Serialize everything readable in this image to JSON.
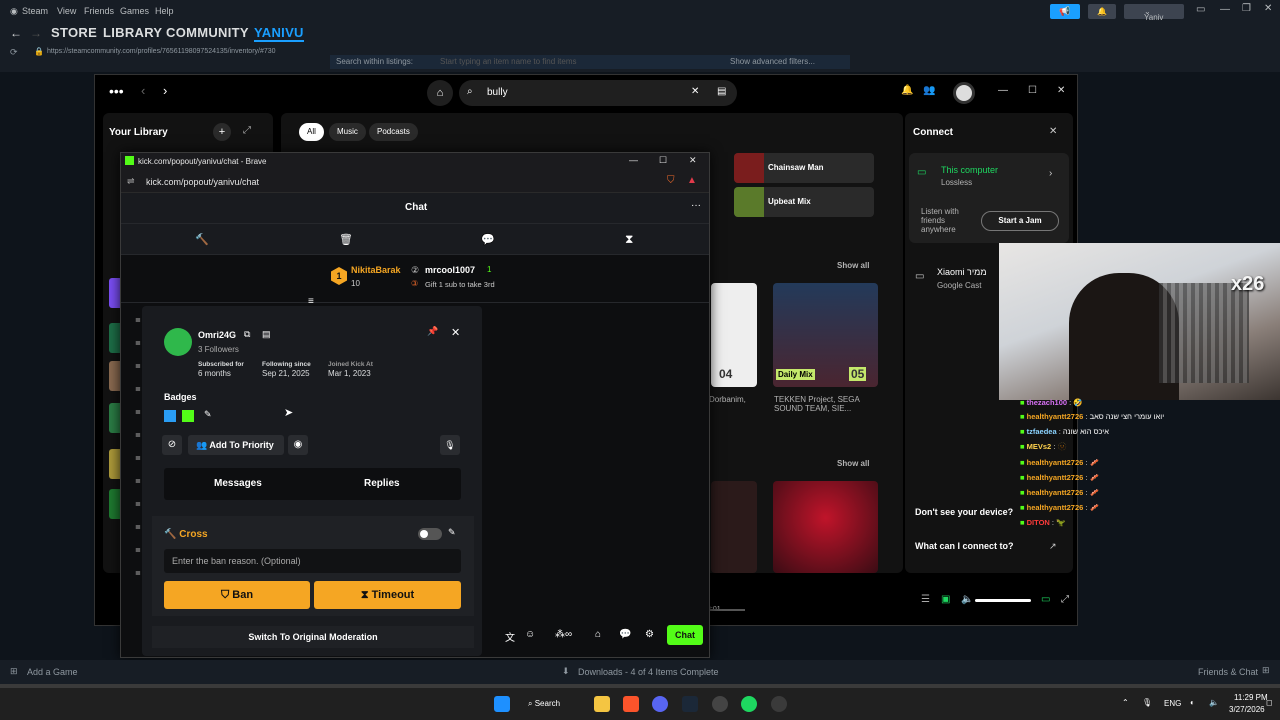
{
  "steam": {
    "menu": [
      "Steam",
      "View",
      "Friends",
      "Games",
      "Help"
    ],
    "nav_tabs": [
      "STORE",
      "LIBRARY",
      "COMMUNITY",
      "YANIVU"
    ],
    "user": "Yaniv",
    "url": "https://steamcommunity.com/profiles/76561198097524135/inventory/#730",
    "search_listings_label": "Search within listings:",
    "search_listings_placeholder": "Start typing an item name to find items",
    "advanced_filters": "Show advanced filters...",
    "add_game": "Add a Game",
    "downloads": "Downloads - 4 of 4 Items Complete",
    "friends_chat": "Friends & Chat"
  },
  "spotify": {
    "search_value": "bully",
    "library_title": "Your Library",
    "filters": [
      "All",
      "Music",
      "Podcasts"
    ],
    "cards": [
      {
        "label": "Chainsaw Man",
        "color": "#7a1d1d"
      },
      {
        "label": "Upbeat Mix",
        "color": "#5a7a2a"
      }
    ],
    "show_all": "Show all",
    "album_titles": [
      "Dorbanim,",
      "TEKKEN Project, SEGA SOUND TEAM, SIE..."
    ],
    "album_badges": [
      "04",
      "05"
    ],
    "daily_mix": "Daily Mix",
    "time": "3:01",
    "connect": {
      "title": "Connect",
      "this_computer": "This computer",
      "lossless": "Lossless",
      "listen_with": "Listen with friends anywhere",
      "start_jam": "Start a Jam",
      "device_name": "Xiaomi ממיר",
      "device_type": "Google Cast",
      "dont_see": "Don't see your device?",
      "what_connect": "What can I connect to?"
    }
  },
  "brave": {
    "title": "kick.com/popout/yanivu/chat - Brave",
    "url": "kick.com/popout/yanivu/chat"
  },
  "kick": {
    "chat_title": "Chat",
    "leader1": {
      "name": "NikitaBarak",
      "count": "10"
    },
    "leader2": {
      "name": "mrcool1007",
      "count": "1",
      "sub": "Gift 1 sub to take 3rd"
    },
    "chat_button": "Chat",
    "profile": {
      "username": "Omri24G",
      "followers": "3 Followers",
      "subscribed_label": "Subscribed for",
      "subscribed_value": "6 months",
      "following_label": "Following since",
      "following_value": "Sep 21, 2025",
      "joined_label": "Joined Kick At",
      "joined_value": "Mar 1, 2023",
      "badges_label": "Badges",
      "add_priority": "Add To Priority",
      "tab_messages": "Messages",
      "tab_replies": "Replies",
      "cross_label": "Cross",
      "ban_placeholder": "Enter the ban reason. (Optional)",
      "ban": "Ban",
      "timeout": "Timeout",
      "switch": "Switch To Original Moderation"
    }
  },
  "overlay_chat": [
    {
      "user": "thezach100",
      "msg": "🤣"
    },
    {
      "user": "healthyantt2726",
      "msg": "יואו עומרי חצי שנה סאב"
    },
    {
      "user": "tzfaedea",
      "msg": "איכס הוא שונה"
    },
    {
      "user": "MEVs2",
      "msg": "🫥"
    },
    {
      "user": "healthyantt2726",
      "msg": "🥓"
    },
    {
      "user": "healthyantt2726",
      "msg": "🥓"
    },
    {
      "user": "healthyantt2726",
      "msg": "🥓"
    },
    {
      "user": "healthyantt2726",
      "msg": "🥓"
    },
    {
      "user": "DITON",
      "msg": "🦖"
    }
  ],
  "webcam_badge": "x26",
  "taskbar": {
    "search": "Search",
    "lang": "ENG",
    "time": "11:29 PM",
    "date": "3/27/2026"
  }
}
